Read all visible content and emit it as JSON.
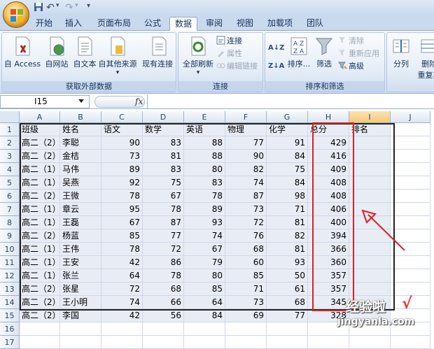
{
  "qat": {
    "undo": "↶",
    "redo": "↷",
    "save": "■",
    "dropdown": "▾"
  },
  "tabs": [
    {
      "label": "开始",
      "active": false
    },
    {
      "label": "插入",
      "active": false
    },
    {
      "label": "页面布局",
      "active": false
    },
    {
      "label": "公式",
      "active": false
    },
    {
      "label": "数据",
      "active": true
    },
    {
      "label": "审阅",
      "active": false
    },
    {
      "label": "视图",
      "active": false
    },
    {
      "label": "加载项",
      "active": false
    },
    {
      "label": "团队",
      "active": false
    }
  ],
  "ribbon": {
    "external": {
      "group_label": "获取外部数据",
      "access": "自 Access",
      "web": "自网站",
      "text": "自文本",
      "other": "自其他来源",
      "existing": "现有连接"
    },
    "connections": {
      "group_label": "连接",
      "refresh_all": "全部刷新",
      "connect": "连接",
      "properties": "属性",
      "edit_links": "编辑链接"
    },
    "sort_filter": {
      "group_label": "排序和筛选",
      "sort_az": "A↓Z",
      "sort_za": "Z↓A",
      "sort": "排序...",
      "filter": "筛选",
      "clear": "清除",
      "reapply": "重新应用",
      "advanced": "高级"
    },
    "data_tools": {
      "split": "分列",
      "remove_dup_1": "删除",
      "remove_dup_2": "重复项"
    }
  },
  "formula_bar": {
    "name_box": "I15",
    "fx": "fx",
    "value": ""
  },
  "columns": [
    "A",
    "B",
    "C",
    "D",
    "E",
    "F",
    "G",
    "H",
    "I",
    "J"
  ],
  "rows": [
    "1",
    "2",
    "3",
    "4",
    "5",
    "6",
    "7",
    "8",
    "9",
    "10",
    "11",
    "12",
    "13",
    "14",
    "15",
    "16",
    "17"
  ],
  "table": {
    "header": [
      "班级",
      "姓名",
      "语文",
      "数学",
      "英语",
      "物理",
      "化学",
      "总分",
      "排名"
    ],
    "data": [
      [
        "高二（2）",
        "李聪",
        "90",
        "83",
        "88",
        "77",
        "91",
        "429",
        ""
      ],
      [
        "高二（2）",
        "金桔",
        "73",
        "81",
        "88",
        "90",
        "84",
        "416",
        ""
      ],
      [
        "高二（1）",
        "马伟",
        "89",
        "83",
        "80",
        "82",
        "75",
        "409",
        ""
      ],
      [
        "高二（1）",
        "吴燕",
        "92",
        "75",
        "83",
        "74",
        "84",
        "408",
        ""
      ],
      [
        "高二（2）",
        "王微",
        "78",
        "67",
        "78",
        "87",
        "98",
        "408",
        ""
      ],
      [
        "高二（1）",
        "章云",
        "95",
        "78",
        "89",
        "73",
        "71",
        "406",
        ""
      ],
      [
        "高二（1）",
        "王磊",
        "67",
        "87",
        "93",
        "72",
        "81",
        "400",
        ""
      ],
      [
        "高二（2）",
        "杨蓝",
        "85",
        "77",
        "74",
        "76",
        "82",
        "394",
        ""
      ],
      [
        "高二（1）",
        "王伟",
        "78",
        "72",
        "67",
        "68",
        "81",
        "366",
        ""
      ],
      [
        "高二（1）",
        "王安",
        "42",
        "86",
        "79",
        "60",
        "93",
        "360",
        ""
      ],
      [
        "高二（1）",
        "张兰",
        "64",
        "78",
        "80",
        "85",
        "50",
        "357",
        ""
      ],
      [
        "高二（2）",
        "张星",
        "72",
        "68",
        "85",
        "71",
        "61",
        "357",
        ""
      ],
      [
        "高二（2）",
        "王小明",
        "74",
        "66",
        "64",
        "73",
        "68",
        "345",
        ""
      ],
      [
        "高二（2）",
        "李国",
        "42",
        "56",
        "84",
        "69",
        "77",
        "328",
        ""
      ]
    ]
  },
  "watermark": {
    "line1": "经验啦",
    "line2": "jingyanla.com",
    "check": "√"
  },
  "colors": {
    "highlight_box": "#e02020",
    "arrow": "#e02020",
    "table_fill": "#e8ecf5"
  }
}
